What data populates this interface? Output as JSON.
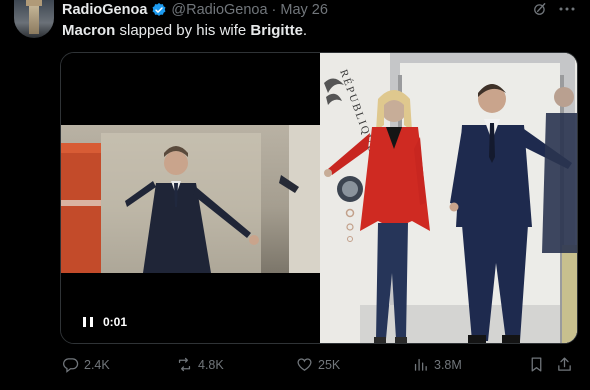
{
  "author": {
    "display_name": "RadioGenoa",
    "handle": "@RadioGenoa",
    "separator": "·",
    "date": "May 26",
    "verified": true
  },
  "tweet": {
    "bold_1": "Macron",
    "text_1": " slapped by his wife ",
    "bold_2": "Brigitte",
    "text_2": "."
  },
  "video": {
    "timestamp": "0:01"
  },
  "photo": {
    "engraving": "RÉPUBLIQUE"
  },
  "actions": {
    "replies": "2.4K",
    "reposts": "4.8K",
    "likes": "25K",
    "views": "3.8M"
  },
  "colors": {
    "background": "#000000",
    "text_primary": "#e7e9ea",
    "text_secondary": "#71767b",
    "verified_blue": "#1d9bf0",
    "border": "#2f3336"
  }
}
